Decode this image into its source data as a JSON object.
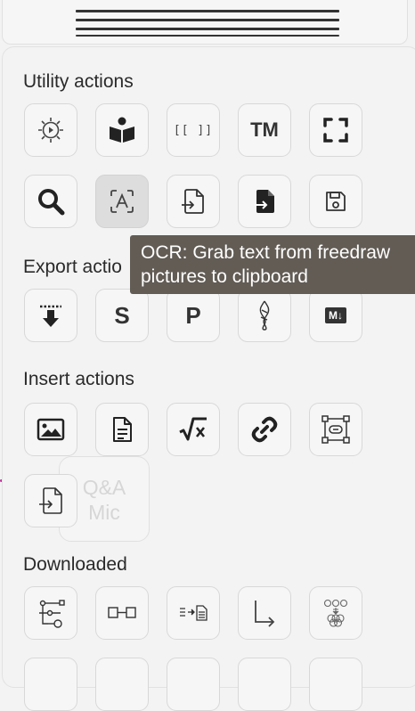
{
  "sections": {
    "utility": "Utility actions",
    "export": "Export actio",
    "insert": "Insert actions",
    "downloaded": "Downloaded"
  },
  "tooltip": {
    "line1": "OCR: Grab text from freedraw",
    "line2": "pictures to clipboard"
  },
  "ghost": {
    "line1": "Q&A",
    "line2": "Mic"
  },
  "buttons": {
    "brackets_glyph": "[[ ]]",
    "tm_glyph": "TM",
    "s_glyph": "S",
    "p_glyph": "P",
    "md_glyph": "M↓"
  },
  "icons": [
    "settings-play-icon",
    "book-reader-icon",
    "wiki-brackets-icon",
    "trademark-icon",
    "fullscreen-icon",
    "search-icon",
    "ocr-text-icon",
    "file-import-icon",
    "file-import-filled-icon",
    "save-icon",
    "export-download-icon",
    "export-svg-icon",
    "export-png-icon",
    "excalidraw-icon",
    "markdown-icon",
    "insert-image-icon",
    "insert-file-icon",
    "latex-sqrt-icon",
    "link-icon",
    "embed-link-icon",
    "file-insert-icon",
    "flowchart-icon",
    "connector-icon",
    "arrow-to-file-icon",
    "elbow-arrow-icon",
    "circles-icon"
  ]
}
